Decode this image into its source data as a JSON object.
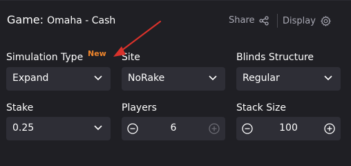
{
  "header": {
    "game_label": "Game:",
    "game_value": "Omaha - Cash",
    "share_label": "Share",
    "display_label": "Display"
  },
  "fields": {
    "simulation_type": {
      "label": "Simulation Type",
      "badge": "New",
      "value": "Expand"
    },
    "site": {
      "label": "Site",
      "value": "NoRake"
    },
    "blinds_structure": {
      "label": "Blinds Structure",
      "value": "Regular"
    },
    "stake": {
      "label": "Stake",
      "value": "0.25"
    },
    "players": {
      "label": "Players",
      "value": "6"
    },
    "stack_size": {
      "label": "Stack Size",
      "value": "100"
    }
  },
  "colors": {
    "background": "#1f1f24",
    "control": "#2e2e36",
    "badge": "#f0862c",
    "annotation_arrow": "#d9322b",
    "muted_text": "#a9a9b4"
  },
  "icons": {
    "share": "share-icon",
    "display": "gear-icon",
    "dropdown": "chevron-down-icon",
    "decrement": "minus-circle-icon",
    "increment": "plus-circle-icon"
  }
}
